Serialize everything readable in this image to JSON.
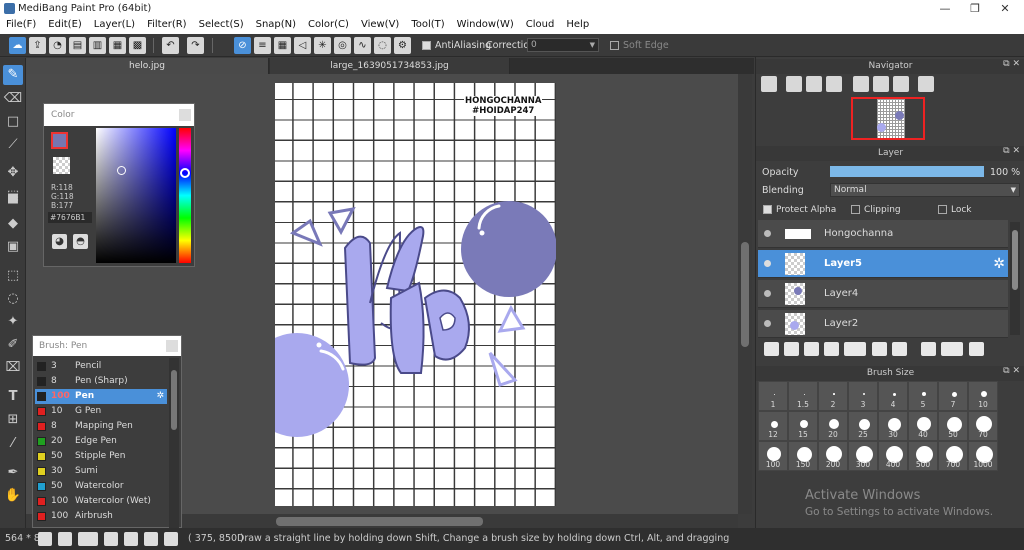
{
  "window": {
    "title": "MediBang Paint Pro (64bit)",
    "min": "—",
    "max": "❐",
    "close": "✕"
  },
  "menu": [
    "File(F)",
    "Edit(E)",
    "Layer(L)",
    "Filter(R)",
    "Select(S)",
    "Snap(N)",
    "Color(C)",
    "View(V)",
    "Tool(T)",
    "Window(W)",
    "Cloud",
    "Help"
  ],
  "toolbar": {
    "antialiasing_label": "AntiAliasing",
    "correction_label": "Correction",
    "correction_value": "0",
    "soft_edge_label": "Soft Edge"
  },
  "tabs": [
    "helo.jpg",
    "large_1639051734853.jpg"
  ],
  "canvas": {
    "text_line1": "HONGOCHANNA",
    "text_line2": "#HOIDAP247"
  },
  "color_panel": {
    "title": "Color",
    "r": "R:118",
    "g": "G:118",
    "b": "B:177",
    "hex": "#7676B1",
    "current_color": "#7676b1"
  },
  "brush_panel": {
    "title": "Brush: Pen",
    "items": [
      {
        "size": "3",
        "name": "Pencil",
        "color": "#222222"
      },
      {
        "size": "8",
        "name": "Pen (Sharp)",
        "color": "#222222"
      },
      {
        "size": "100",
        "name": "Pen",
        "color": "#222222"
      },
      {
        "size": "10",
        "name": "G Pen",
        "color": "#e02020"
      },
      {
        "size": "8",
        "name": "Mapping Pen",
        "color": "#e02020"
      },
      {
        "size": "20",
        "name": "Edge Pen",
        "color": "#20a020"
      },
      {
        "size": "50",
        "name": "Stipple Pen",
        "color": "#e0d020"
      },
      {
        "size": "30",
        "name": "Sumi",
        "color": "#e0d020"
      },
      {
        "size": "50",
        "name": "Watercolor",
        "color": "#20a0d0"
      },
      {
        "size": "100",
        "name": "Watercolor (Wet)",
        "color": "#e02020"
      },
      {
        "size": "100",
        "name": "Airbrush",
        "color": "#e02020"
      }
    ]
  },
  "navigator": {
    "title": "Navigator"
  },
  "layer_panel": {
    "title": "Layer",
    "opacity_label": "Opacity",
    "opacity_value": "100 %",
    "opacity_fraction": 1.0,
    "blending_label": "Blending",
    "blending_value": "Normal",
    "protect_alpha": "Protect Alpha",
    "clipping": "Clipping",
    "lock": "Lock",
    "layers": [
      "Hongochanna",
      "Layer5",
      "Layer4",
      "Layer2"
    ]
  },
  "brush_size_panel": {
    "title": "Brush Size",
    "sizes": [
      "1",
      "1.5",
      "2",
      "3",
      "4",
      "5",
      "7",
      "10",
      "12",
      "15",
      "20",
      "25",
      "30",
      "40",
      "50",
      "70",
      "100",
      "150",
      "200",
      "300",
      "400",
      "500",
      "700",
      "1000"
    ]
  },
  "status": {
    "zoom": "564 * 8",
    "coords": "( 375, 850 )",
    "hint": "Draw a straight line by holding down Shift, Change a brush size by holding down Ctrl, Alt, and dragging"
  },
  "watermark": {
    "line1": "Activate Windows",
    "line2": "Go to Settings to activate Windows."
  },
  "colors": {
    "accent": "#4a90d9",
    "paint": "#a7a7f0",
    "paint_dark": "#7878b8",
    "outline": "#4a4a8a"
  }
}
